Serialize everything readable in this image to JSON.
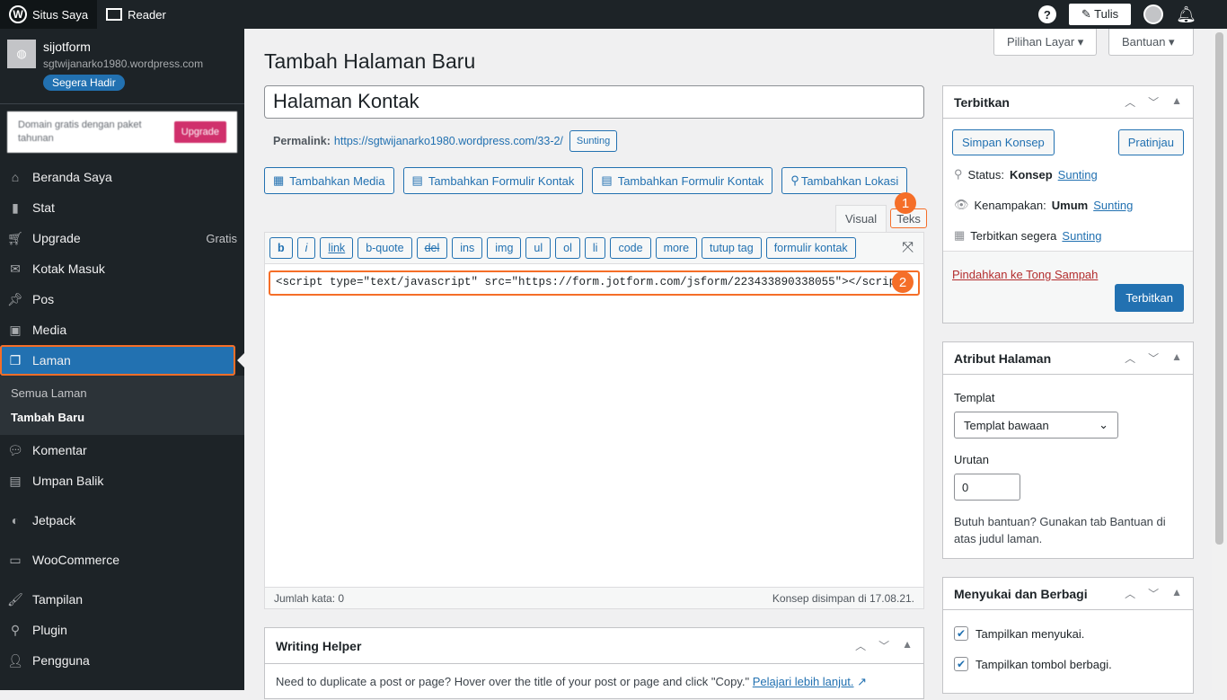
{
  "topbar": {
    "site": "Situs Saya",
    "reader": "Reader",
    "write": "Tulis"
  },
  "site": {
    "name": "sijotform",
    "url": "sgtwijanarko1980.wordpress.com",
    "badge": "Segera Hadir"
  },
  "promo": {
    "text": "Domain gratis dengan paket tahunan",
    "button": "Upgrade"
  },
  "menu": [
    {
      "label": "Beranda Saya",
      "icon": "home-icon"
    },
    {
      "label": "Stat",
      "icon": "stats-icon"
    },
    {
      "label": "Upgrade",
      "icon": "cart-icon",
      "extra": "Gratis"
    },
    {
      "label": "Kotak Masuk",
      "icon": "mail-icon"
    },
    {
      "label": "Pos",
      "icon": "pin-icon"
    },
    {
      "label": "Media",
      "icon": "media-icon"
    },
    {
      "label": "Laman",
      "icon": "page-icon"
    }
  ],
  "submenu": [
    "Semua Laman",
    "Tambah Baru"
  ],
  "menu2": [
    {
      "label": "Komentar"
    },
    {
      "label": "Umpan Balik"
    },
    {
      "label": "Jetpack"
    },
    {
      "label": "WooCommerce"
    },
    {
      "label": "Tampilan"
    },
    {
      "label": "Plugin"
    },
    {
      "label": "Pengguna"
    }
  ],
  "screen": {
    "options": "Pilihan Layar ▾",
    "help": "Bantuan ▾"
  },
  "page": {
    "heading": "Tambah Halaman Baru",
    "title": "Halaman Kontak",
    "permalink_label": "Permalink:",
    "permalink": "https://sgtwijanarko1980.wordpress.com/33-2/",
    "edit": "Sunting"
  },
  "media_buttons": [
    "Tambahkan Media",
    "Tambahkan Formulir Kontak",
    "Tambahkan Formulir Kontak",
    "Tambahkan Lokasi"
  ],
  "tabs": {
    "visual": "Visual",
    "text": "Teks"
  },
  "quicktags": [
    "b",
    "i",
    "link",
    "b-quote",
    "del",
    "ins",
    "img",
    "ul",
    "ol",
    "li",
    "code",
    "more",
    "tutup tag",
    "formulir kontak"
  ],
  "content": "<script type=\"text/javascript\" src=\"https://form.jotform.com/jsform/223433890338055\"></script>",
  "status": {
    "words": "Jumlah kata: 0",
    "saved": "Konsep disimpan di 17.08.21."
  },
  "steps": [
    "1",
    "2"
  ],
  "helper": {
    "title": "Writing Helper",
    "text": "Need to duplicate a post or page? Hover over the title of your post or page and click \"Copy.\"",
    "link": "Pelajari lebih lanjut."
  },
  "publish": {
    "title": "Terbitkan",
    "save": "Simpan Konsep",
    "preview": "Pratinjau",
    "status_label": "Status:",
    "status": "Konsep",
    "vis_label": "Kenampakan:",
    "vis": "Umum",
    "sched": "Terbitkan segera",
    "edit": "Sunting",
    "trash": "Pindahkan ke Tong Sampah",
    "publish": "Terbitkan"
  },
  "attr": {
    "title": "Atribut Halaman",
    "template_label": "Templat",
    "template": "Templat bawaan",
    "order_label": "Urutan",
    "order": "0",
    "help": "Butuh bantuan? Gunakan tab Bantuan di atas judul laman."
  },
  "share": {
    "title": "Menyukai dan Berbagi",
    "likes": "Tampilkan menyukai.",
    "share": "Tampilkan tombol berbagi."
  }
}
